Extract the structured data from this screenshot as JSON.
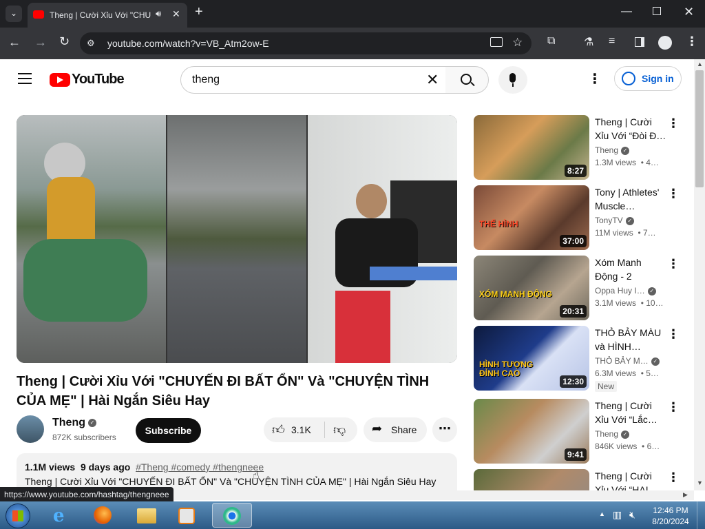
{
  "browser": {
    "tab_title": "Theng | Cười Xỉu Với \"CHU",
    "url": "youtube.com/watch?v=VB_Atm2ow-E",
    "status_url": "https://www.youtube.com/hashtag/thengneee"
  },
  "header": {
    "logo_text": "YouTube",
    "search_value": "theng",
    "signin_label": "Sign in"
  },
  "video": {
    "title": "Theng | Cười Xỉu Với \"CHUYẾN ĐI BẤT ỔN\" Và \"CHUYỆN TÌNH CỦA MẸ\" | Hài Ngắn Siêu Hay",
    "channel": "Theng",
    "subscribers": "872K subscribers",
    "subscribe_label": "Subscribe",
    "likes": "3.1K",
    "share_label": "Share",
    "views": "1.1M views",
    "age": "9 days ago",
    "hashtags": "#Theng #comedy #thengneee",
    "desc_line": "Theng | Cười Xỉu Với \"CHUYẾN ĐI BẤT ỔN\" Và \"CHUYỆN TÌNH CỦA MẸ\" | Hài Ngắn Siêu Hay"
  },
  "recommendations": [
    {
      "title": "Theng | Cười Xỉu Với “Đòi Đ…",
      "channel": "Theng",
      "verified": true,
      "views": "1.3M views",
      "age": "• 4…",
      "duration": "8:27",
      "badge": ""
    },
    {
      "title": "Tony | Athletes' Muscle…",
      "channel": "TonyTV",
      "verified": true,
      "views": "11M views",
      "age": "• 7…",
      "duration": "37:00",
      "badge": ""
    },
    {
      "title": "Xóm Manh Động - 2",
      "channel": "Oppa Huy I…",
      "verified": true,
      "views": "3.1M views",
      "age": "• 10…",
      "duration": "20:31",
      "badge": ""
    },
    {
      "title": "THỎ BẢY MÀU và HÌNH…",
      "channel": "THỎ BẢY M…",
      "verified": true,
      "views": "6.3M views",
      "age": "• 5…",
      "duration": "12:30",
      "badge": "New"
    },
    {
      "title": "Theng | Cười Xỉu Với “Lắc…",
      "channel": "Theng",
      "verified": true,
      "views": "846K views",
      "age": "• 6…",
      "duration": "9:41",
      "badge": ""
    },
    {
      "title": "Theng | Cười Xỉu Với “HAI…",
      "channel": "",
      "verified": false,
      "views": "",
      "age": "",
      "duration": "",
      "badge": ""
    }
  ],
  "thumb_text": {
    "rec2_overlay": "THỂ HÌNH",
    "rec3_overlay": "XÓM MANH ĐỘNG",
    "rec4_overlay": "HÌNH TƯỢNG ĐỈNH CAO"
  },
  "taskbar": {
    "time": "12:46 PM",
    "date": "8/20/2024"
  },
  "colors": {
    "youtube_red": "#ff0000",
    "link_blue": "#065fd4",
    "chrome_dark": "#202124"
  }
}
